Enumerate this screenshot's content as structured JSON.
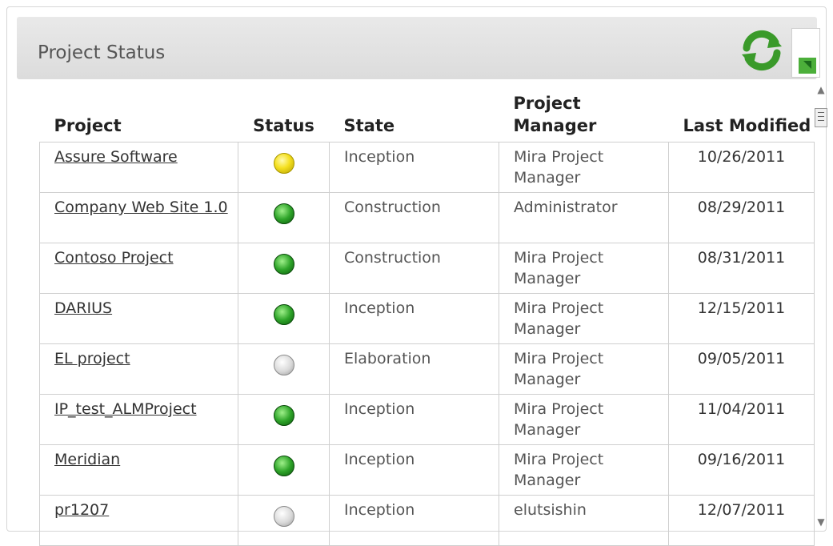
{
  "widget": {
    "title": "Project Status",
    "refresh_icon": "refresh-icon",
    "export_icon": "export-icon"
  },
  "table": {
    "headers": {
      "project": "Project",
      "status": "Status",
      "state": "State",
      "manager": "Project Manager",
      "modified": "Last Modified"
    },
    "rows": [
      {
        "project": "Assure Software",
        "status": "yellow",
        "state": "Inception",
        "manager": "Mira Project Manager",
        "modified": "10/26/2011"
      },
      {
        "project": "Company Web Site 1.0",
        "status": "green",
        "state": "Construction",
        "manager": "Administrator",
        "modified": "08/29/2011"
      },
      {
        "project": "Contoso Project",
        "status": "green",
        "state": "Construction",
        "manager": "Mira Project Manager",
        "modified": "08/31/2011"
      },
      {
        "project": "DARIUS",
        "status": "green",
        "state": "Inception",
        "manager": "Mira Project Manager",
        "modified": "12/15/2011"
      },
      {
        "project": "EL project",
        "status": "grey",
        "state": "Elaboration",
        "manager": "Mira Project Manager",
        "modified": "09/05/2011"
      },
      {
        "project": "IP_test_ALMProject",
        "status": "green",
        "state": "Inception",
        "manager": "Mira Project Manager",
        "modified": "11/04/2011"
      },
      {
        "project": "Meridian",
        "status": "green",
        "state": "Inception",
        "manager": "Mira Project Manager",
        "modified": "09/16/2011"
      },
      {
        "project": "pr1207",
        "status": "grey",
        "state": "Inception",
        "manager": "elutsishin",
        "modified": "12/07/2011"
      }
    ]
  }
}
